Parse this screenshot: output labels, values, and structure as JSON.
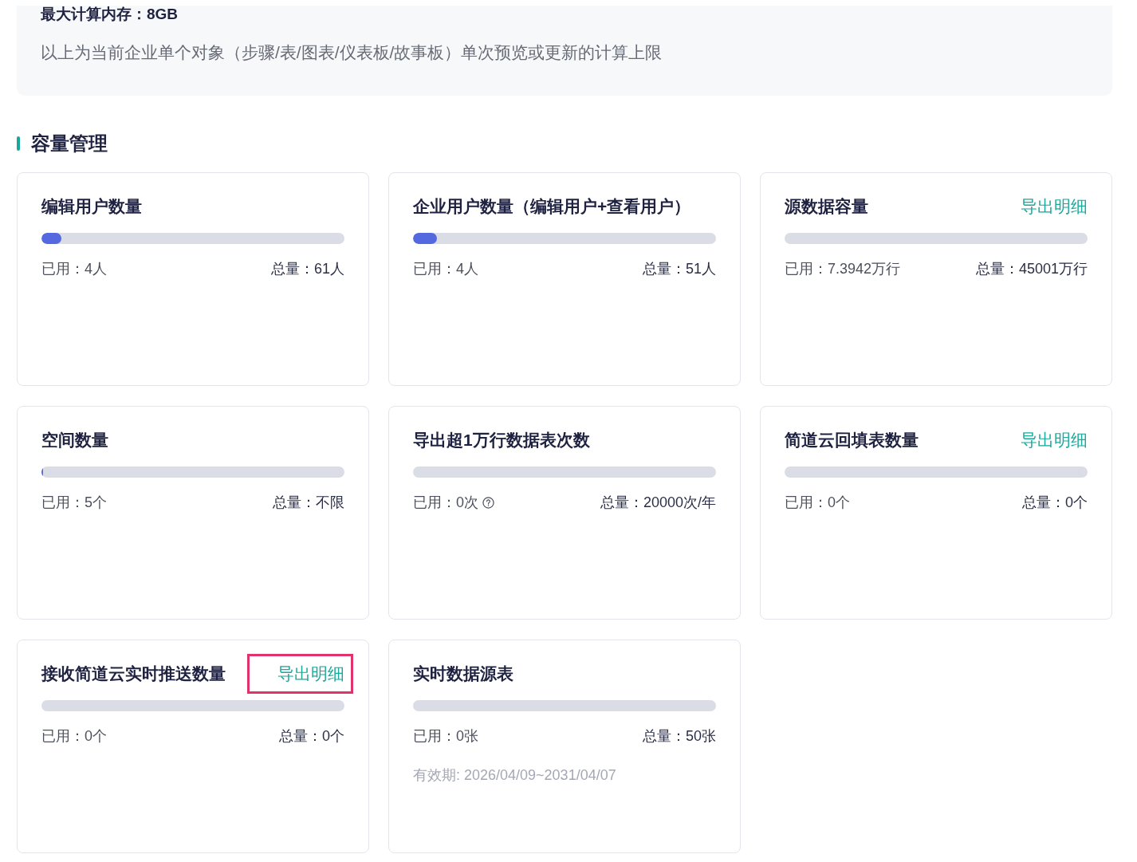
{
  "info_panel": {
    "limit": "最大计算内存：8GB",
    "description": "以上为当前企业单个对象（步骤/表/图表/仪表板/故事板）单次预览或更新的计算上限"
  },
  "section": {
    "title": "容量管理"
  },
  "cards": [
    {
      "title": "编辑用户数量",
      "level": 0.066,
      "used": "已用：4人",
      "total": "总量：61人",
      "help_icon": false
    },
    {
      "title": "企业用户数量（编辑用户+查看用户）",
      "level": 0.078,
      "used": "已用：4人",
      "total": "总量：51人",
      "help_icon": false
    },
    {
      "title": "源数据容量",
      "action": "导出明细",
      "action_highlighted": false,
      "used": "已用：7.3942万行",
      "total": "总量：45001万行",
      "help_icon": false
    },
    {
      "title": "空间数量",
      "level": 0.005,
      "used": "已用：5个",
      "total": "总量：不限",
      "help_icon": false
    },
    {
      "title": "导出超1万行数据表次数",
      "used": "已用：0次",
      "total": "总量：20000次/年",
      "help_icon": true
    },
    {
      "title": "简道云回填表数量",
      "action": "导出明细",
      "action_highlighted": false,
      "used": "已用：0个",
      "total": "总量：0个",
      "help_icon": false
    },
    {
      "title": "接收简道云实时推送数量",
      "action": "导出明细",
      "action_highlighted": true,
      "used": "已用：0个",
      "total": "总量：0个",
      "help_icon": false
    },
    {
      "title": "实时数据源表",
      "used": "已用：0张",
      "total": "总量：50张",
      "help_icon": false,
      "note": "有效期: 2026/04/09~2031/04/07"
    }
  ]
}
